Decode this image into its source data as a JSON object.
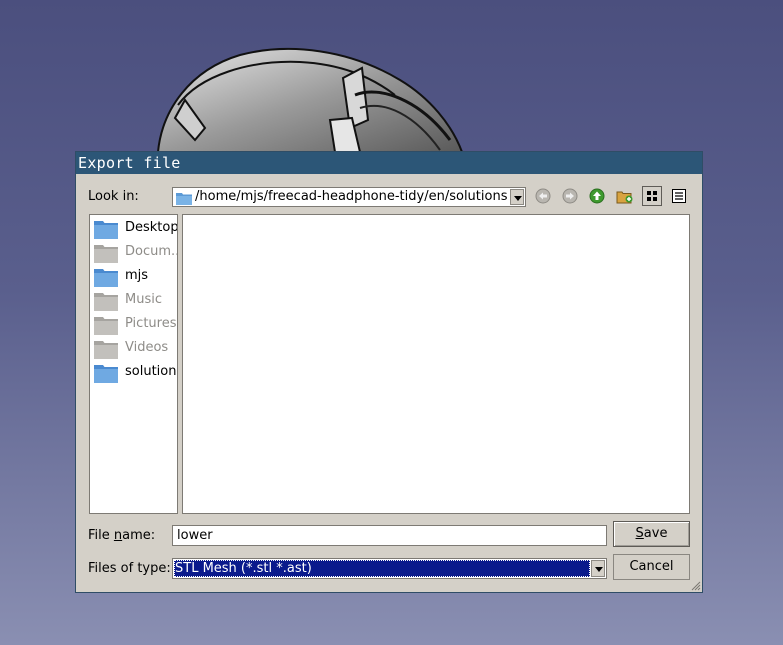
{
  "dialog": {
    "title": "Export file",
    "look_in_label_pre": "Look in:",
    "look_in_path": "/home/mjs/freecad-headphone-tidy/en/solutions",
    "toolbar": {
      "back_icon": "arrow-left-icon",
      "forward_icon": "arrow-right-icon",
      "up_icon": "arrow-up-icon",
      "new_folder_icon": "new-folder-icon",
      "icon_view_icon": "icon-view-icon",
      "detail_view_icon": "detail-view-icon"
    },
    "sidebar": {
      "items": [
        {
          "label": "Desktop",
          "enabled": true
        },
        {
          "label": "Docum...",
          "enabled": false
        },
        {
          "label": "mjs",
          "enabled": true
        },
        {
          "label": "Music",
          "enabled": false
        },
        {
          "label": "Pictures",
          "enabled": false
        },
        {
          "label": "Videos",
          "enabled": false
        },
        {
          "label": "solutions",
          "enabled": true
        }
      ]
    },
    "file_name_label_pre": "File ",
    "file_name_label_u": "n",
    "file_name_label_post": "ame:",
    "file_name_value": "lower",
    "files_of_type_label": "Files of type:",
    "files_of_type_value": "STL Mesh (*.stl *.ast)",
    "save_pre": "",
    "save_u": "S",
    "save_post": "ave",
    "cancel_label": "Cancel"
  },
  "colors": {
    "titlebar": "#2c5677",
    "folder_blue": "#5b9ad6",
    "selection": "#0a1a8c",
    "up_arrow_green": "#3e9a2e"
  }
}
